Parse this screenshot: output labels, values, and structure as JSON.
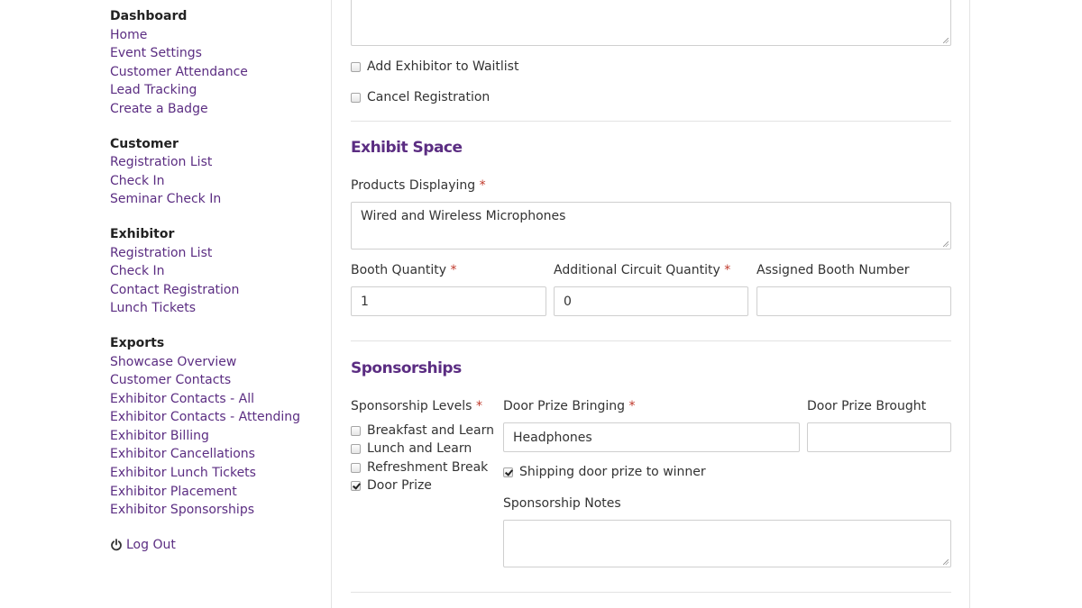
{
  "sidebar": {
    "groups": [
      {
        "heading": "Dashboard",
        "links": [
          "Home",
          "Event Settings",
          "Customer Attendance",
          "Lead Tracking",
          "Create a Badge"
        ]
      },
      {
        "heading": "Customer",
        "links": [
          "Registration List",
          "Check In",
          "Seminar Check In"
        ]
      },
      {
        "heading": "Exhibitor",
        "links": [
          "Registration List",
          "Check In",
          "Contact Registration",
          "Lunch Tickets"
        ]
      },
      {
        "heading": "Exports",
        "links": [
          "Showcase Overview",
          "Customer Contacts",
          "Exhibitor Contacts - All",
          "Exhibitor Contacts - Attending",
          "Exhibitor Billing",
          "Exhibitor Cancellations",
          "Exhibitor Lunch Tickets",
          "Exhibitor Placement",
          "Exhibitor Sponsorships"
        ]
      }
    ],
    "logout_label": "Log Out"
  },
  "form": {
    "top_textarea_value": "",
    "add_waitlist_label": "Add Exhibitor to Waitlist",
    "add_waitlist_checked": false,
    "cancel_registration_label": "Cancel Registration",
    "cancel_registration_checked": false,
    "exhibit_space": {
      "title": "Exhibit Space",
      "products_label": "Products Displaying",
      "products_value": "Wired and Wireless Microphones",
      "booth_qty_label": "Booth Quantity",
      "booth_qty_value": "1",
      "circuit_qty_label": "Additional Circuit Quantity",
      "circuit_qty_value": "0",
      "booth_number_label": "Assigned Booth Number",
      "booth_number_value": ""
    },
    "sponsorships": {
      "title": "Sponsorships",
      "levels_label": "Sponsorship Levels",
      "levels": [
        {
          "label": "Breakfast and Learn",
          "checked": false
        },
        {
          "label": "Lunch and Learn",
          "checked": false
        },
        {
          "label": "Refreshment Break",
          "checked": false
        },
        {
          "label": "Door Prize",
          "checked": true
        }
      ],
      "door_prize_bringing_label": "Door Prize Bringing",
      "door_prize_bringing_value": "Headphones",
      "door_prize_brought_label": "Door Prize Brought",
      "door_prize_brought_value": "",
      "shipping_label": "Shipping door prize to winner",
      "shipping_checked": true,
      "notes_label": "Sponsorship Notes",
      "notes_value": ""
    },
    "required_marker": "*"
  },
  "colors": {
    "accent": "#5b2d82",
    "required": "#c0392b",
    "border": "#cfcfcf"
  }
}
